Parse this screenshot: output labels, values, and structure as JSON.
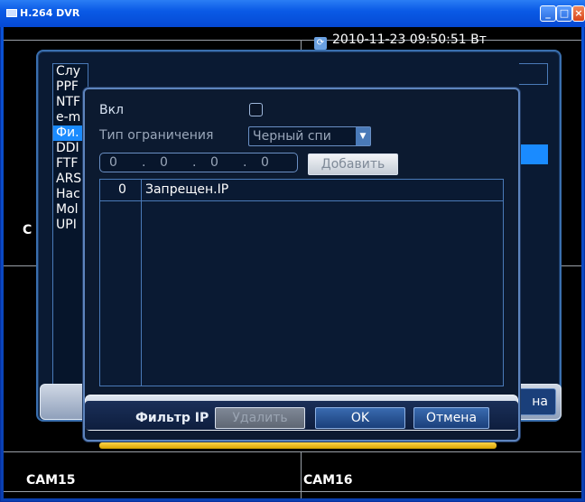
{
  "window": {
    "title": "H.264 DVR"
  },
  "screen": {
    "timestamp": "2010-11-23 09:50:51 Вт",
    "cam_bottom_left": "CAM15",
    "cam_bottom_right": "CAM16",
    "side_letter": "C"
  },
  "network_menu": {
    "items": [
      {
        "label": "Слу"
      },
      {
        "label": "PPF"
      },
      {
        "label": "NTF"
      },
      {
        "label": "e-m"
      },
      {
        "label": "Фи."
      },
      {
        "label": "DDI"
      },
      {
        "label": "FTF"
      },
      {
        "label": "ARS"
      },
      {
        "label": "Нас"
      },
      {
        "label": "Mol"
      },
      {
        "label": "UPI"
      }
    ],
    "selected_index": 4,
    "right_button_label": "на"
  },
  "ip_filter_dialog": {
    "enable_label": "Вкл",
    "enable_checked": false,
    "restriction_type_label": "Тип ограничения",
    "restriction_type_value": "Черный спи",
    "ip_octets": [
      "0",
      "0",
      "0",
      "0"
    ],
    "add_button_label": "Добавить",
    "table": {
      "columns": [
        "0",
        "Запрещен.IP"
      ],
      "rows": []
    },
    "footer_title": "Фильтр IP",
    "delete_button_label": "Удалить",
    "ok_button_label": "OK",
    "cancel_button_label": "Отмена"
  }
}
